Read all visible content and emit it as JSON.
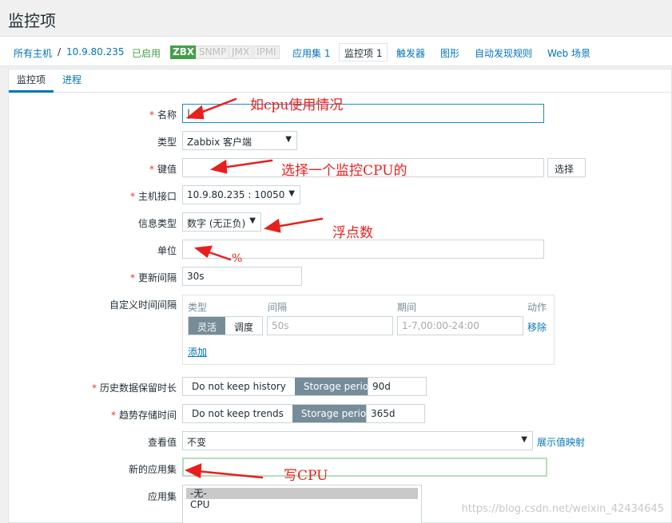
{
  "page": {
    "title": "监控项"
  },
  "breadcrumbs": {
    "all_hosts": "所有主机",
    "separator": "/",
    "host": "10.9.80.235",
    "status": "已启用",
    "badges": [
      "ZBX",
      "SNMP",
      "JMX",
      "IPMI"
    ],
    "links": [
      "应用集 1",
      "监控项 1",
      "触发器",
      "图形",
      "自动发现规则",
      "Web 场景"
    ]
  },
  "tabs": [
    "监控项",
    "进程"
  ],
  "form": {
    "name": {
      "label": "名称",
      "value": "|"
    },
    "type": {
      "label": "类型",
      "value": "Zabbix 客户端"
    },
    "key": {
      "label": "键值",
      "value": "",
      "button": "选择"
    },
    "interface": {
      "label": "主机接口",
      "value": "10.9.80.235 : 10050"
    },
    "info_type": {
      "label": "信息类型",
      "value": "数字 (无正负)"
    },
    "units": {
      "label": "单位",
      "value": ""
    },
    "interval": {
      "label": "更新间隔",
      "value": "30s"
    },
    "custom_intervals": {
      "label": "自定义时间间隔",
      "headers": [
        "类型",
        "间隔",
        "期间",
        "动作"
      ],
      "type_options": [
        "灵活",
        "调度"
      ],
      "interval_placeholder": "50s",
      "period_placeholder": "1-7,00:00-24:00",
      "remove": "移除",
      "add": "添加"
    },
    "history": {
      "label": "历史数据保留时长",
      "options": [
        "Do not keep history",
        "Storage period"
      ],
      "value": "90d"
    },
    "trends": {
      "label": "趋势存储时间",
      "options": [
        "Do not keep trends",
        "Storage period"
      ],
      "value": "365d"
    },
    "valuemap": {
      "label": "查看值",
      "value": "不变",
      "link": "展示值映射"
    },
    "new_app": {
      "label": "新的应用集",
      "value": ""
    },
    "apps": {
      "label": "应用集",
      "options": [
        "-无-",
        "CPU"
      ]
    }
  },
  "annotations": {
    "name": "如cpu使用情况",
    "key": "选择一个监控CPU的",
    "info_type": "浮点数",
    "units": "%",
    "new_app": "写CPU"
  },
  "watermark": "https://blog.csdn.net/weixin_42434645",
  "colors": {
    "link": "#0275b8",
    "enabled": "#429e47",
    "required": "#e33734",
    "annotation": "#e8201d",
    "segment_active": "#768d99"
  }
}
